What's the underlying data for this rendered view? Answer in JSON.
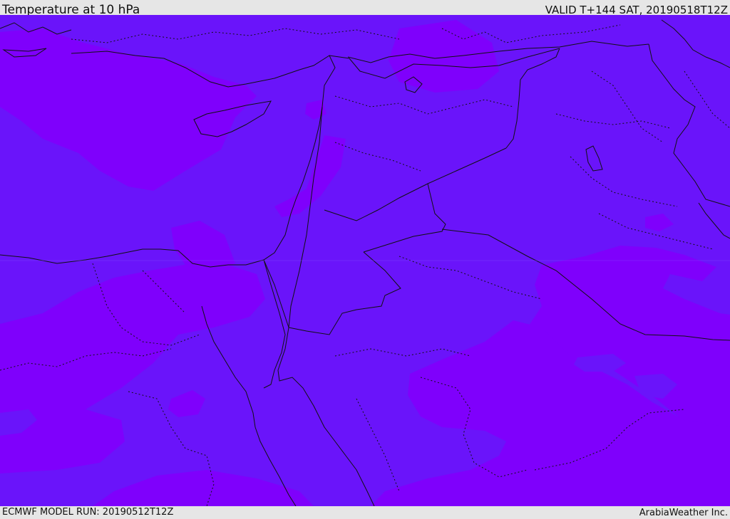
{
  "header": {
    "title": "Temperature at 10 hPa",
    "valid": "VALID T+144 SAT, 20190518T12Z"
  },
  "footer": {
    "model_run": "ECMWF MODEL RUN: 20190512T12Z",
    "credit": "ArabiaWeather Inc."
  },
  "map": {
    "region": "Eastern Mediterranean and Middle East",
    "field": "temperature",
    "level": "10 hPa",
    "colors": {
      "band_cool": "#6a14fa",
      "band_warm": "#7f00fc",
      "coastline": "#111111",
      "border": "#111111"
    }
  }
}
